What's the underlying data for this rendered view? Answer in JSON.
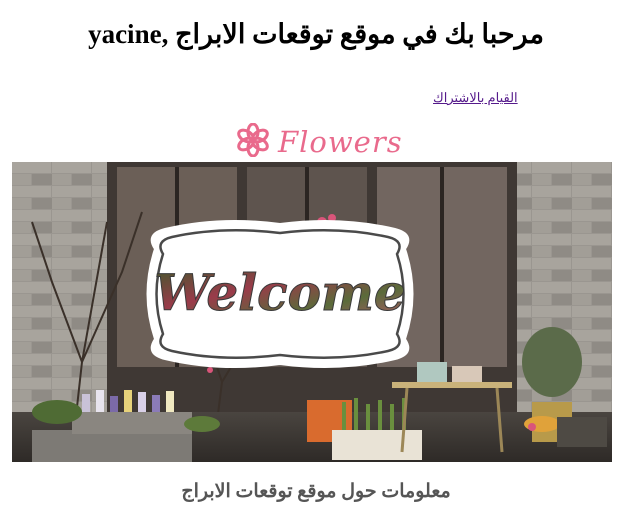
{
  "header": {
    "welcome_text": "مرحبا بك في موقع توقعات الابراج ,yacine"
  },
  "nav": {
    "subscribe_link": "القيام بالاشتراك"
  },
  "logo": {
    "text": "Flowers",
    "icon": "flower-icon"
  },
  "banner": {
    "welcome_text": "Welcome"
  },
  "info": {
    "heading": "معلومات حول موقع توقعات الابراج"
  },
  "colors": {
    "logo_pink": "#e96a8c",
    "link_visited": "#551a8b",
    "info_heading": "#555555"
  }
}
